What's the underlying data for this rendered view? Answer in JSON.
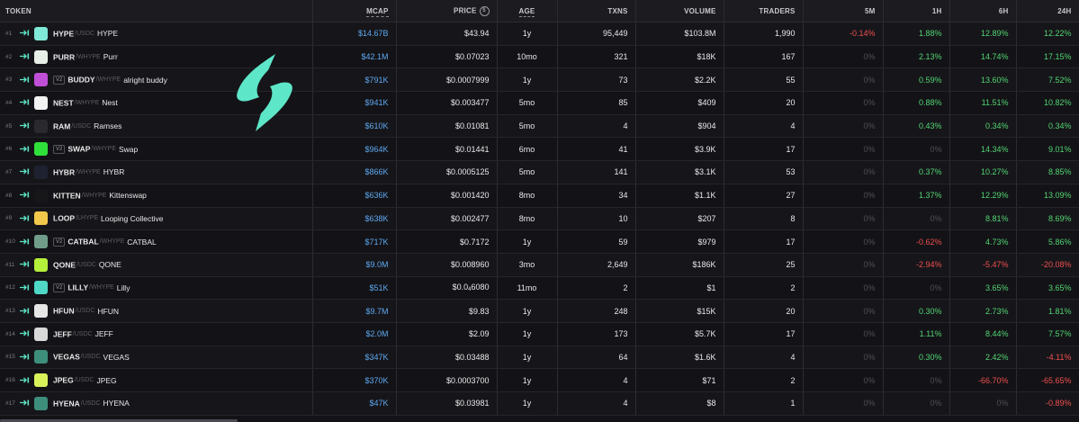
{
  "headers": {
    "token": "TOKEN",
    "mcap": "MCAP",
    "price": "PRICE",
    "price_icon": "$",
    "age": "AGE",
    "txns": "TXNS",
    "volume": "VOLUME",
    "traders": "TRADERS",
    "m5": "5M",
    "h1": "1H",
    "h6": "6H",
    "h24": "24H"
  },
  "colors": {
    "positive": "#53d472",
    "negative": "#f04e4e",
    "neutral": "#4e4e55",
    "mcap": "#5fa8f0",
    "accent": "#5ee6c8"
  },
  "rows": [
    {
      "rank": "#1",
      "icon": "hype-logo-icon",
      "color": "#7fe8d6",
      "v2": "",
      "symbol": "HYPE",
      "quote": "/USDC",
      "name": "HYPE",
      "mcap": "$14.67B",
      "price": "$43.94",
      "age": "1y",
      "txns": "95,449",
      "volume": "$103.8M",
      "traders": "1,990",
      "m5": "-0.14%",
      "m5_s": "neg",
      "h1": "1.88%",
      "h1_s": "pos",
      "h6": "12.89%",
      "h6_s": "pos",
      "h24": "12.22%",
      "h24_s": "pos"
    },
    {
      "rank": "#2",
      "icon": "purr-logo-icon",
      "color": "#e8efe9",
      "v2": "",
      "symbol": "PURR",
      "quote": "/WHYPE",
      "name": "Purr",
      "mcap": "$42.1M",
      "price": "$0.07023",
      "age": "10mo",
      "txns": "321",
      "volume": "$18K",
      "traders": "167",
      "m5": "0%",
      "m5_s": "zero",
      "h1": "2.13%",
      "h1_s": "pos",
      "h6": "14.74%",
      "h6_s": "pos",
      "h24": "17.15%",
      "h24_s": "pos"
    },
    {
      "rank": "#3",
      "icon": "buddy-logo-icon",
      "color": "#c04fd8",
      "v2": "V2",
      "symbol": "BUDDY",
      "quote": "/WHYPE",
      "name": "alright buddy",
      "mcap": "$791K",
      "price": "$0.0007999",
      "age": "1y",
      "txns": "73",
      "volume": "$2.2K",
      "traders": "55",
      "m5": "0%",
      "m5_s": "zero",
      "h1": "0.59%",
      "h1_s": "pos",
      "h6": "13.60%",
      "h6_s": "pos",
      "h24": "7.52%",
      "h24_s": "pos"
    },
    {
      "rank": "#4",
      "icon": "nest-logo-icon",
      "color": "#f2f2f2",
      "v2": "",
      "symbol": "NEST",
      "quote": "/WHYPE",
      "name": "Nest",
      "mcap": "$941K",
      "price": "$0.003477",
      "age": "5mo",
      "txns": "85",
      "volume": "$409",
      "traders": "20",
      "m5": "0%",
      "m5_s": "zero",
      "h1": "0.88%",
      "h1_s": "pos",
      "h6": "11.51%",
      "h6_s": "pos",
      "h24": "10.82%",
      "h24_s": "pos"
    },
    {
      "rank": "#5",
      "icon": "ram-logo-icon",
      "color": "#2a2a2e",
      "v2": "",
      "symbol": "RAM",
      "quote": "/USDC",
      "name": "Ramses",
      "mcap": "$610K",
      "price": "$0.01081",
      "age": "5mo",
      "txns": "4",
      "volume": "$904",
      "traders": "4",
      "m5": "0%",
      "m5_s": "zero",
      "h1": "0.43%",
      "h1_s": "pos",
      "h6": "0.34%",
      "h6_s": "pos",
      "h24": "0.34%",
      "h24_s": "pos"
    },
    {
      "rank": "#6",
      "icon": "swap-logo-icon",
      "color": "#2fe03a",
      "v2": "V2",
      "symbol": "SWAP",
      "quote": "/WHYPE",
      "name": "Swap",
      "mcap": "$964K",
      "price": "$0.01441",
      "age": "6mo",
      "txns": "41",
      "volume": "$3.9K",
      "traders": "17",
      "m5": "0%",
      "m5_s": "zero",
      "h1": "0%",
      "h1_s": "zero",
      "h6": "14.34%",
      "h6_s": "pos",
      "h24": "9.01%",
      "h24_s": "pos"
    },
    {
      "rank": "#7",
      "icon": "hybr-logo-icon",
      "color": "#1e2230",
      "v2": "",
      "symbol": "HYBR",
      "quote": "/WHYPE",
      "name": "HYBR",
      "mcap": "$866K",
      "price": "$0.0005125",
      "age": "5mo",
      "txns": "141",
      "volume": "$3.1K",
      "traders": "53",
      "m5": "0%",
      "m5_s": "zero",
      "h1": "0.37%",
      "h1_s": "pos",
      "h6": "10.27%",
      "h6_s": "pos",
      "h24": "8.85%",
      "h24_s": "pos"
    },
    {
      "rank": "#8",
      "icon": "kitten-logo-icon",
      "color": "#17171a",
      "v2": "",
      "symbol": "KITTEN",
      "quote": "/WHYPE",
      "name": "Kittenswap",
      "mcap": "$636K",
      "price": "$0.001420",
      "age": "8mo",
      "txns": "34",
      "volume": "$1.1K",
      "traders": "27",
      "m5": "0%",
      "m5_s": "zero",
      "h1": "1.37%",
      "h1_s": "pos",
      "h6": "12.29%",
      "h6_s": "pos",
      "h24": "13.09%",
      "h24_s": "pos"
    },
    {
      "rank": "#9",
      "icon": "loop-logo-icon",
      "color": "#f2c84b",
      "v2": "",
      "symbol": "LOOP",
      "quote": "/LHYPE",
      "name": "Looping Collective",
      "mcap": "$638K",
      "price": "$0.002477",
      "age": "8mo",
      "txns": "10",
      "volume": "$207",
      "traders": "8",
      "m5": "0%",
      "m5_s": "zero",
      "h1": "0%",
      "h1_s": "zero",
      "h6": "8.81%",
      "h6_s": "pos",
      "h24": "8.69%",
      "h24_s": "pos"
    },
    {
      "rank": "#10",
      "icon": "catbal-logo-icon",
      "color": "#6f9d8a",
      "v2": "V2",
      "symbol": "CATBAL",
      "quote": "/WHYPE",
      "name": "CATBAL",
      "mcap": "$717K",
      "price": "$0.7172",
      "age": "1y",
      "txns": "59",
      "volume": "$979",
      "traders": "17",
      "m5": "0%",
      "m5_s": "zero",
      "h1": "-0.62%",
      "h1_s": "neg",
      "h6": "4.73%",
      "h6_s": "pos",
      "h24": "5.86%",
      "h24_s": "pos"
    },
    {
      "rank": "#11",
      "icon": "qone-logo-icon",
      "color": "#b5f03a",
      "v2": "",
      "symbol": "QONE",
      "quote": "/USDC",
      "name": "QONE",
      "mcap": "$9.0M",
      "price": "$0.008960",
      "age": "3mo",
      "txns": "2,649",
      "volume": "$186K",
      "traders": "25",
      "m5": "0%",
      "m5_s": "zero",
      "h1": "-2.94%",
      "h1_s": "neg",
      "h6": "-5.47%",
      "h6_s": "neg",
      "h24": "-20.08%",
      "h24_s": "neg"
    },
    {
      "rank": "#12",
      "icon": "lilly-logo-icon",
      "color": "#4fd8c6",
      "v2": "V2",
      "symbol": "LILLY",
      "quote": "/WHYPE",
      "name": "Lilly",
      "mcap": "$51K",
      "price": "$0.0",
      "price_sub": "4",
      "price_rest": "6080",
      "age": "11mo",
      "txns": "2",
      "volume": "$1",
      "traders": "2",
      "m5": "0%",
      "m5_s": "zero",
      "h1": "0%",
      "h1_s": "zero",
      "h6": "3.65%",
      "h6_s": "pos",
      "h24": "3.65%",
      "h24_s": "pos"
    },
    {
      "rank": "#13",
      "icon": "hfun-logo-icon",
      "color": "#e6e6e6",
      "v2": "",
      "symbol": "HFUN",
      "quote": "/USDC",
      "name": "HFUN",
      "mcap": "$9.7M",
      "price": "$9.83",
      "age": "1y",
      "txns": "248",
      "volume": "$15K",
      "traders": "20",
      "m5": "0%",
      "m5_s": "zero",
      "h1": "0.30%",
      "h1_s": "pos",
      "h6": "2.73%",
      "h6_s": "pos",
      "h24": "1.81%",
      "h24_s": "pos"
    },
    {
      "rank": "#14",
      "icon": "jeff-logo-icon",
      "color": "#d8d8d8",
      "v2": "",
      "symbol": "JEFF",
      "quote": "/USDC",
      "name": "JEFF",
      "mcap": "$2.0M",
      "price": "$2.09",
      "age": "1y",
      "txns": "173",
      "volume": "$5.7K",
      "traders": "17",
      "m5": "0%",
      "m5_s": "zero",
      "h1": "1.11%",
      "h1_s": "pos",
      "h6": "8.44%",
      "h6_s": "pos",
      "h24": "7.57%",
      "h24_s": "pos"
    },
    {
      "rank": "#15",
      "icon": "vegas-logo-icon",
      "color": "#3d8f7c",
      "v2": "",
      "symbol": "VEGAS",
      "quote": "/USDC",
      "name": "VEGAS",
      "mcap": "$347K",
      "price": "$0.03488",
      "age": "1y",
      "txns": "64",
      "volume": "$1.6K",
      "traders": "4",
      "m5": "0%",
      "m5_s": "zero",
      "h1": "0.30%",
      "h1_s": "pos",
      "h6": "2.42%",
      "h6_s": "pos",
      "h24": "-4.11%",
      "h24_s": "neg"
    },
    {
      "rank": "#16",
      "icon": "jpeg-logo-icon",
      "color": "#d9f25a",
      "v2": "",
      "symbol": "JPEG",
      "quote": "/USDC",
      "name": "JPEG",
      "mcap": "$370K",
      "price": "$0.0003700",
      "age": "1y",
      "txns": "4",
      "volume": "$71",
      "traders": "2",
      "m5": "0%",
      "m5_s": "zero",
      "h1": "0%",
      "h1_s": "zero",
      "h6": "-66.70%",
      "h6_s": "neg",
      "h24": "-65.65%",
      "h24_s": "neg"
    },
    {
      "rank": "#17",
      "icon": "hyena-logo-icon",
      "color": "#3d8f7c",
      "v2": "",
      "symbol": "HYENA",
      "quote": "/USDC",
      "name": "HYENA",
      "mcap": "$47K",
      "price": "$0.03981",
      "age": "1y",
      "txns": "4",
      "volume": "$8",
      "traders": "1",
      "m5": "0%",
      "m5_s": "zero",
      "h1": "0%",
      "h1_s": "zero",
      "h6": "0%",
      "h6_s": "zero",
      "h24": "-0.89%",
      "h24_s": "neg"
    }
  ]
}
